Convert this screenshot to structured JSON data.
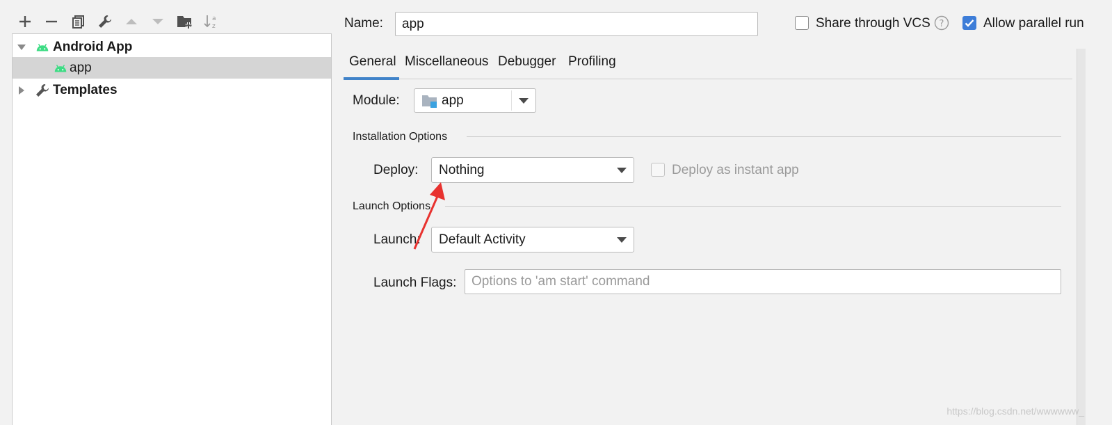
{
  "toolbar": {
    "add": "add-icon",
    "remove": "minus-icon",
    "copy": "copy-icon",
    "edit_defaults": "wrench-icon",
    "move_up": "arrow-up-icon",
    "move_down": "arrow-down-icon",
    "new_folder": "folder-add-icon",
    "sort": "sort-az-icon"
  },
  "tree": {
    "items": [
      {
        "label": "Android App",
        "icon": "android-icon",
        "expanded": true
      },
      {
        "label": "app",
        "icon": "android-icon",
        "selected": true
      },
      {
        "label": "Templates",
        "icon": "wrench-icon",
        "expanded": false
      }
    ]
  },
  "header": {
    "name_label": "Name:",
    "name_value": "app",
    "share_vcs_label": "Share through VCS",
    "share_vcs_checked": false,
    "allow_parallel_label": "Allow parallel run",
    "allow_parallel_checked": true
  },
  "tabs": [
    {
      "label": "General",
      "active": true
    },
    {
      "label": "Miscellaneous"
    },
    {
      "label": "Debugger"
    },
    {
      "label": "Profiling"
    }
  ],
  "general": {
    "module_label": "Module:",
    "module_value": "app",
    "installation_title": "Installation Options",
    "deploy_label": "Deploy:",
    "deploy_value": "Nothing",
    "instant_app_label": "Deploy as instant app",
    "instant_app_checked": false,
    "launch_title": "Launch Options",
    "launch_label": "Launch:",
    "launch_value": "Default Activity",
    "launch_flags_label": "Launch Flags:",
    "launch_flags_placeholder": "Options to 'am start' command",
    "launch_flags_value": ""
  },
  "watermark": "https://blog.csdn.net/wwwwww_",
  "colors": {
    "android_green": "#3ddc84",
    "accent_blue": "#4083c9",
    "checkbox_blue": "#3d7dd8",
    "annotation_arrow": "#e8322f"
  }
}
